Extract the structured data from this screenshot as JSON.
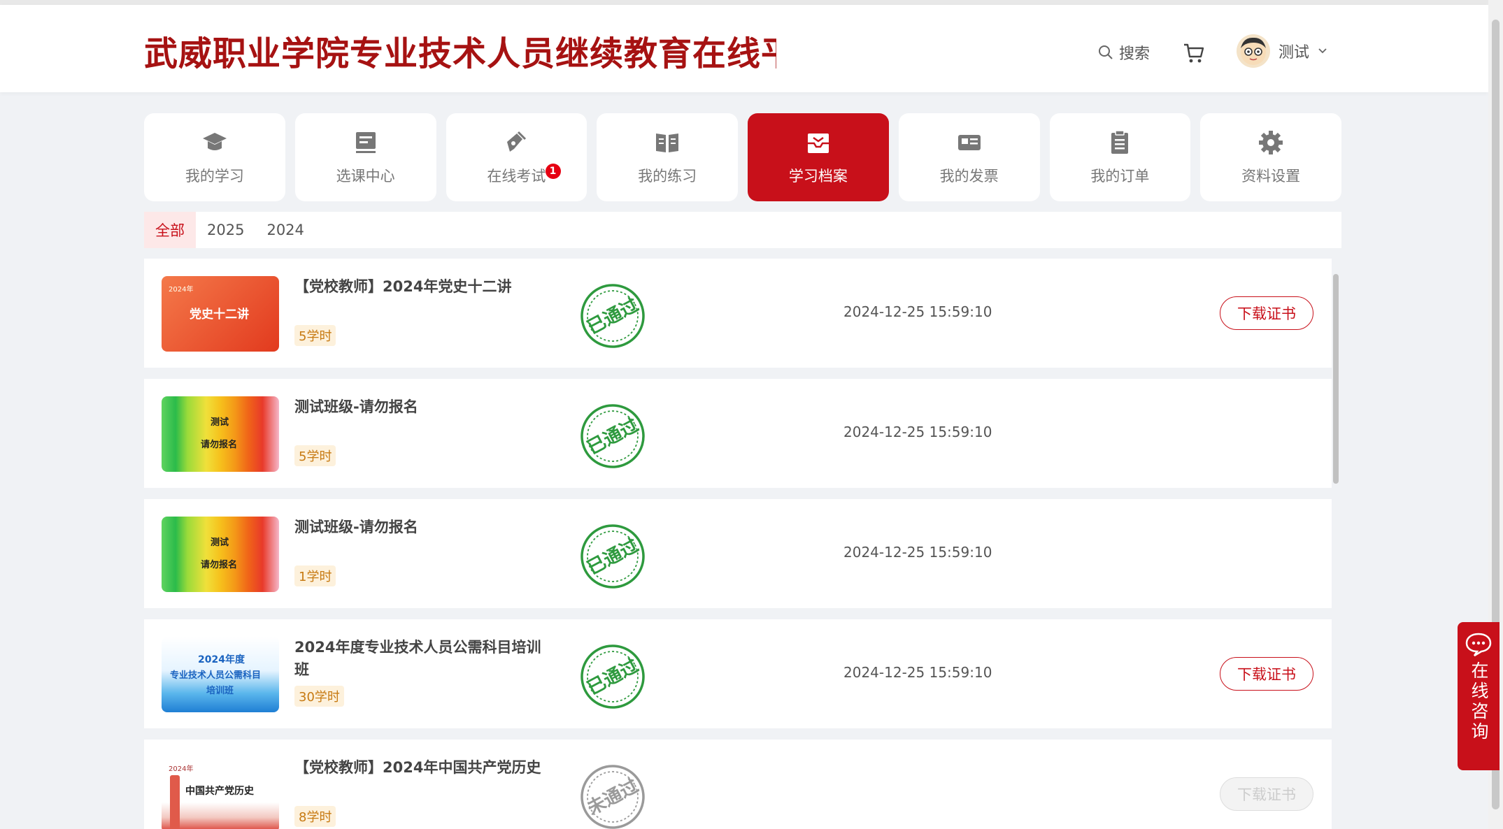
{
  "header": {
    "site_title": "武威职业学院专业技术人员继续教育在线平台",
    "search_label": "搜索",
    "user_name": "测试"
  },
  "nav": {
    "items": [
      {
        "label": "我的学习",
        "icon": "graduation-cap-icon"
      },
      {
        "label": "选课中心",
        "icon": "book-list-icon"
      },
      {
        "label": "在线考试",
        "icon": "pen-icon",
        "badge": "1"
      },
      {
        "label": "我的练习",
        "icon": "open-book-icon"
      },
      {
        "label": "学习档案",
        "icon": "archive-tray-icon",
        "active": true
      },
      {
        "label": "我的发票",
        "icon": "invoice-icon"
      },
      {
        "label": "我的订单",
        "icon": "clipboard-icon"
      },
      {
        "label": "资料设置",
        "icon": "gear-icon"
      }
    ]
  },
  "year_tabs": {
    "items": [
      "全部",
      "2025",
      "2024"
    ],
    "active": "全部"
  },
  "records": [
    {
      "title": "【党校教师】2024年党史十二讲",
      "hours": "5学时",
      "status": "已通过",
      "date": "2024-12-25 15:59:10",
      "cert": "下载证书",
      "thumb_text": "党史十二讲",
      "thumb_small": "2024年"
    },
    {
      "title": "测试班级-请勿报名",
      "hours": "5学时",
      "status": "已通过",
      "date": "2024-12-25 15:59:10",
      "thumb_text1": "测试",
      "thumb_text2": "请勿报名"
    },
    {
      "title": "测试班级-请勿报名",
      "hours": "1学时",
      "status": "已通过",
      "date": "2024-12-25 15:59:10",
      "thumb_text1": "测试",
      "thumb_text2": "请勿报名"
    },
    {
      "title": "2024年度专业技术人员公需科目培训班",
      "hours": "30学时",
      "status": "已通过",
      "date": "2024-12-25 15:59:10",
      "cert": "下载证书",
      "thumb_l1": "2024年度",
      "thumb_l2": "专业技术人员公需科目",
      "thumb_l3": "培训班"
    },
    {
      "title": "【党校教师】2024年中国共产党历史",
      "hours": "8学时",
      "status": "未通过",
      "date": "",
      "cert": "下载证书",
      "thumb_small": "2024年",
      "thumb_text": "中国共产党历史"
    }
  ],
  "consult": {
    "label": "在线咨询"
  },
  "colors": {
    "brand_red": "#c8101a",
    "pass_green": "#2e9a3e",
    "fail_gray": "#9a9a9a"
  }
}
